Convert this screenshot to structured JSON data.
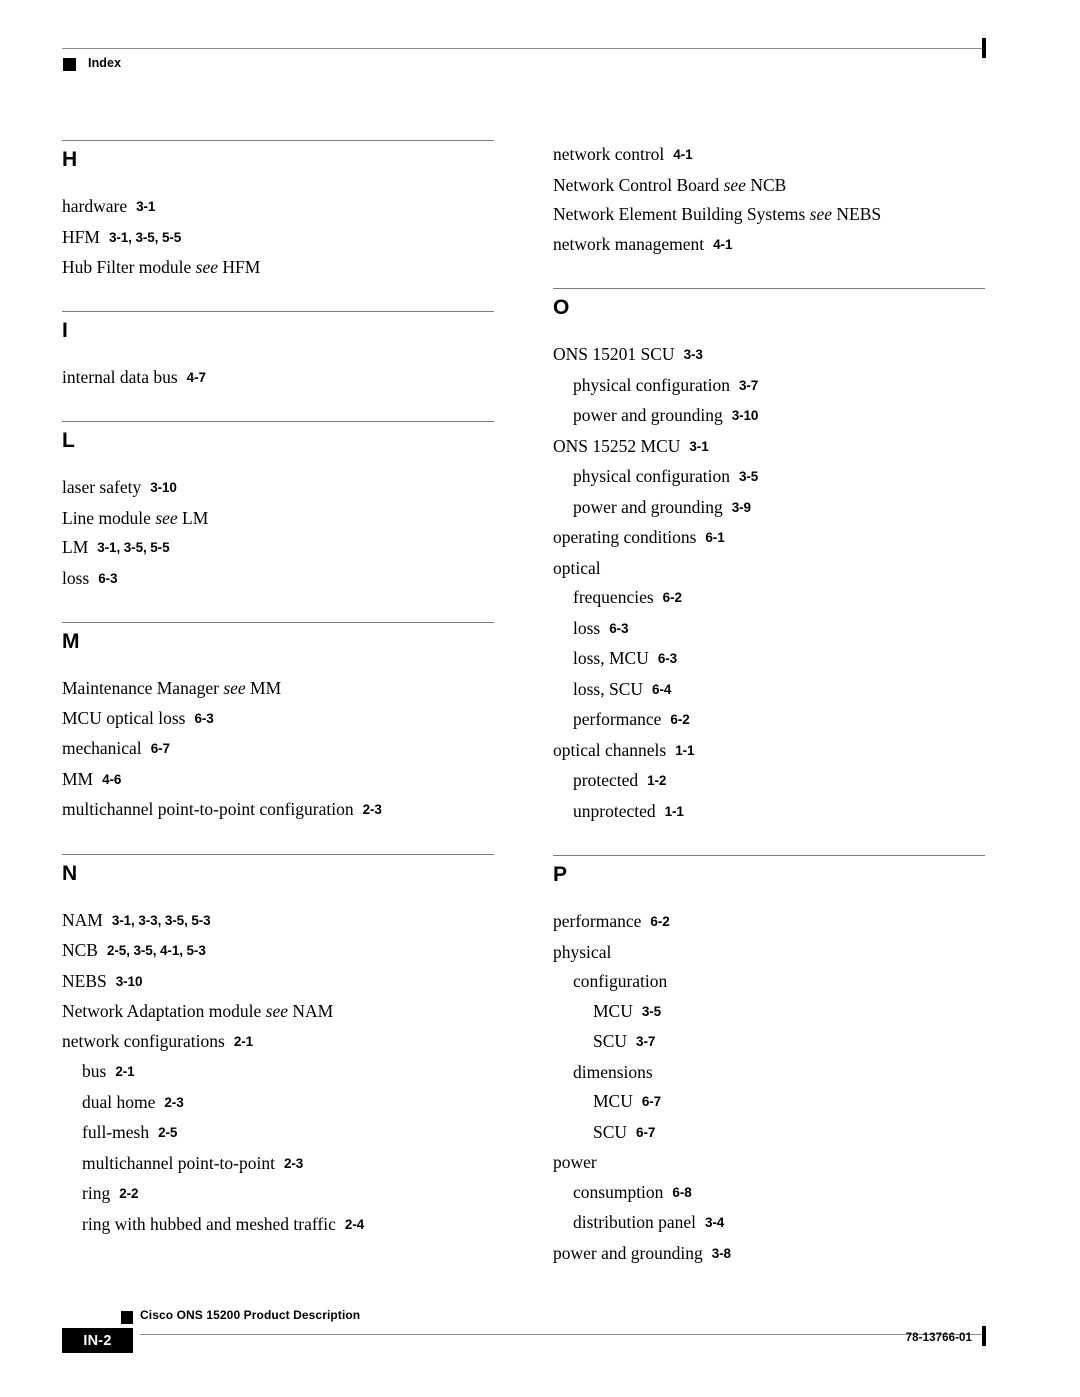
{
  "header": {
    "label": "Index",
    "bullet_icon": "square-bullet-icon"
  },
  "footer": {
    "page_number": "IN-2",
    "title": "Cisco ONS 15200 Product Description",
    "doc_number": "78-13766-01",
    "bullet_icon": "square-bullet-icon"
  },
  "columns": {
    "left": [
      {
        "letter": "H",
        "entries": [
          {
            "level": 0,
            "term": "hardware",
            "see": "",
            "ref": "3-1"
          },
          {
            "level": 0,
            "term": "HFM",
            "see": "",
            "ref": "3-1, 3-5, 5-5"
          },
          {
            "level": 0,
            "term": "Hub Filter module",
            "see": "see HFM",
            "ref": ""
          }
        ]
      },
      {
        "letter": "I",
        "entries": [
          {
            "level": 0,
            "term": "internal data bus",
            "see": "",
            "ref": "4-7"
          }
        ]
      },
      {
        "letter": "L",
        "entries": [
          {
            "level": 0,
            "term": "laser safety",
            "see": "",
            "ref": "3-10"
          },
          {
            "level": 0,
            "term": "Line module",
            "see": "see LM",
            "ref": ""
          },
          {
            "level": 0,
            "term": "LM",
            "see": "",
            "ref": "3-1, 3-5, 5-5"
          },
          {
            "level": 0,
            "term": "loss",
            "see": "",
            "ref": "6-3"
          }
        ]
      },
      {
        "letter": "M",
        "entries": [
          {
            "level": 0,
            "term": "Maintenance Manager",
            "see": "see MM",
            "ref": ""
          },
          {
            "level": 0,
            "term": "MCU optical loss",
            "see": "",
            "ref": "6-3"
          },
          {
            "level": 0,
            "term": "mechanical",
            "see": "",
            "ref": "6-7"
          },
          {
            "level": 0,
            "term": "MM",
            "see": "",
            "ref": "4-6"
          },
          {
            "level": 0,
            "term": "multichannel point-to-point configuration",
            "see": "",
            "ref": "2-3"
          }
        ]
      },
      {
        "letter": "N",
        "entries": [
          {
            "level": 0,
            "term": "NAM",
            "see": "",
            "ref": "3-1, 3-3, 3-5, 5-3"
          },
          {
            "level": 0,
            "term": "NCB",
            "see": "",
            "ref": "2-5, 3-5, 4-1, 5-3"
          },
          {
            "level": 0,
            "term": "NEBS",
            "see": "",
            "ref": "3-10"
          },
          {
            "level": 0,
            "term": "Network Adaptation module",
            "see": "see NAM",
            "ref": ""
          },
          {
            "level": 0,
            "term": "network configurations",
            "see": "",
            "ref": "2-1"
          },
          {
            "level": 1,
            "term": "bus",
            "see": "",
            "ref": "2-1"
          },
          {
            "level": 1,
            "term": "dual home",
            "see": "",
            "ref": "2-3"
          },
          {
            "level": 1,
            "term": "full-mesh",
            "see": "",
            "ref": "2-5"
          },
          {
            "level": 1,
            "term": "multichannel point-to-point",
            "see": "",
            "ref": "2-3"
          },
          {
            "level": 1,
            "term": "ring",
            "see": "",
            "ref": "2-2"
          },
          {
            "level": 1,
            "term": "ring with hubbed and meshed traffic",
            "see": "",
            "ref": "2-4"
          }
        ]
      }
    ],
    "right": [
      {
        "letter": "",
        "entries": [
          {
            "level": 0,
            "term": "network control",
            "see": "",
            "ref": "4-1"
          },
          {
            "level": 0,
            "term": "Network Control Board",
            "see": "see NCB",
            "ref": ""
          },
          {
            "level": 0,
            "term": "Network Element Building Systems",
            "see": "see NEBS",
            "ref": ""
          },
          {
            "level": 0,
            "term": "network management",
            "see": "",
            "ref": "4-1"
          }
        ]
      },
      {
        "letter": "O",
        "entries": [
          {
            "level": 0,
            "term": "ONS 15201 SCU",
            "see": "",
            "ref": "3-3"
          },
          {
            "level": 1,
            "term": "physical configuration",
            "see": "",
            "ref": "3-7"
          },
          {
            "level": 1,
            "term": "power and grounding",
            "see": "",
            "ref": "3-10"
          },
          {
            "level": 0,
            "term": "ONS 15252 MCU",
            "see": "",
            "ref": "3-1"
          },
          {
            "level": 1,
            "term": "physical configuration",
            "see": "",
            "ref": "3-5"
          },
          {
            "level": 1,
            "term": "power and grounding",
            "see": "",
            "ref": "3-9"
          },
          {
            "level": 0,
            "term": "operating conditions",
            "see": "",
            "ref": "6-1"
          },
          {
            "level": 0,
            "term": "optical",
            "see": "",
            "ref": ""
          },
          {
            "level": 1,
            "term": "frequencies",
            "see": "",
            "ref": "6-2"
          },
          {
            "level": 1,
            "term": "loss",
            "see": "",
            "ref": "6-3"
          },
          {
            "level": 1,
            "term": "loss, MCU",
            "see": "",
            "ref": "6-3"
          },
          {
            "level": 1,
            "term": "loss, SCU",
            "see": "",
            "ref": "6-4"
          },
          {
            "level": 1,
            "term": "performance",
            "see": "",
            "ref": "6-2"
          },
          {
            "level": 0,
            "term": "optical channels",
            "see": "",
            "ref": "1-1"
          },
          {
            "level": 1,
            "term": "protected",
            "see": "",
            "ref": "1-2"
          },
          {
            "level": 1,
            "term": "unprotected",
            "see": "",
            "ref": "1-1"
          }
        ]
      },
      {
        "letter": "P",
        "entries": [
          {
            "level": 0,
            "term": "performance",
            "see": "",
            "ref": "6-2"
          },
          {
            "level": 0,
            "term": "physical",
            "see": "",
            "ref": ""
          },
          {
            "level": 1,
            "term": "configuration",
            "see": "",
            "ref": ""
          },
          {
            "level": 2,
            "term": "MCU",
            "see": "",
            "ref": "3-5"
          },
          {
            "level": 2,
            "term": "SCU",
            "see": "",
            "ref": "3-7"
          },
          {
            "level": 1,
            "term": "dimensions",
            "see": "",
            "ref": ""
          },
          {
            "level": 2,
            "term": "MCU",
            "see": "",
            "ref": "6-7"
          },
          {
            "level": 2,
            "term": "SCU",
            "see": "",
            "ref": "6-7"
          },
          {
            "level": 0,
            "term": "power",
            "see": "",
            "ref": ""
          },
          {
            "level": 1,
            "term": "consumption",
            "see": "",
            "ref": "6-8"
          },
          {
            "level": 1,
            "term": "distribution panel",
            "see": "",
            "ref": "3-4"
          },
          {
            "level": 0,
            "term": "power and grounding",
            "see": "",
            "ref": "3-8"
          }
        ]
      }
    ]
  }
}
